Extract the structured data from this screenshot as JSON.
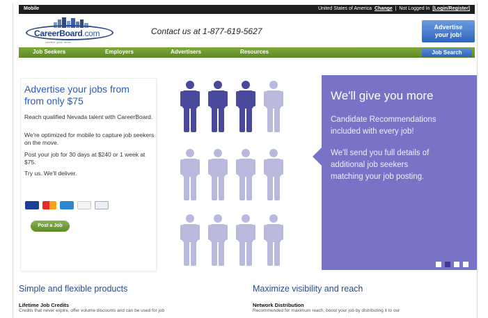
{
  "topbar": {
    "mobile": "Mobile",
    "country": "United States of America",
    "change": "Change",
    "separator": "|",
    "status": "Not Logged In",
    "login": "[Login/Register]"
  },
  "header": {
    "logo_name": "CareerBoard",
    "logo_com": ".com",
    "logo_tag": "connect. grow. thrive.",
    "contact": "Contact us at 1-877-619-5627",
    "advertise_line1": "Advertise",
    "advertise_line2": "your job!"
  },
  "nav": {
    "items": [
      "Job Seekers",
      "Employers",
      "Advertisers",
      "Resources"
    ],
    "job_search": "Job Search"
  },
  "left_panel": {
    "title": "Advertise your jobs from from only $75",
    "p1": "Reach qualified Nevada talent with CareerBoard.",
    "p2": "We're optimized for mobile to capture job seekers on the move.",
    "p3": "Post your job for 30 days at $240 or 1 week at $75.",
    "p4": "Try us.  We'll deliver.",
    "cards": [
      "VISA",
      "MC",
      "AMEX",
      "DISC",
      "PP"
    ],
    "post_button": "Post a Job"
  },
  "people": {
    "filled": 3,
    "total": 12,
    "colors": {
      "filled": "#4a4a9c",
      "empty": "#b9b9de"
    }
  },
  "promo": {
    "heading": "We'll give you more",
    "line1": "Candidate Recommendations",
    "line2": "included with every job!",
    "line3": "We'll send you full details of",
    "line4": "additional job seekers",
    "line5": "matching your job posting.",
    "slides": 4,
    "active_slide": 2
  },
  "bottom": {
    "left_heading": "Simple and flexible products",
    "left_sub": "Lifetime Job Credits",
    "left_text": "Credits that never expire, offer volume discounts and can be used for job",
    "right_heading": "Maximize visibility and reach",
    "right_sub": "Network Distribution",
    "right_text": "Recommended for maximum reach, boost your job by distributing it to our"
  },
  "colors": {
    "accent_blue": "#2a5ab5",
    "nav_green": "#6b9a2c",
    "promo_purple": "#7774c7",
    "button_blue": "#2f65bf"
  }
}
